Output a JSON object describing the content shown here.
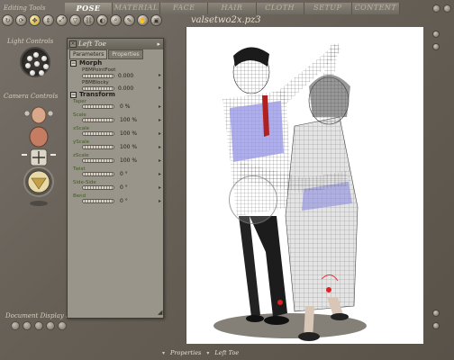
{
  "app": {
    "editing_tools_label": "Editing Tools",
    "document_title": "valsetwo2x.pz3"
  },
  "tabs": [
    "POSE",
    "MATERIAL",
    "FACE",
    "HAIR",
    "CLOTH",
    "SETUP",
    "CONTENT"
  ],
  "active_tab": "POSE",
  "tools": [
    {
      "icon": "rotate-icon"
    },
    {
      "icon": "twist-icon"
    },
    {
      "icon": "translate-icon"
    },
    {
      "icon": "translate-in-out-icon"
    },
    {
      "icon": "scale-icon"
    },
    {
      "icon": "taper-icon"
    },
    {
      "icon": "chain-break-icon"
    },
    {
      "icon": "color-icon"
    },
    {
      "icon": "view-magnifier-icon"
    },
    {
      "icon": "morph-brush-icon"
    },
    {
      "icon": "direct-manipulation-icon"
    },
    {
      "icon": "grouping-icon"
    }
  ],
  "left": {
    "light_controls_label": "Light Controls",
    "camera_controls_label": "Camera Controls",
    "document_display_label": "Document Display St"
  },
  "panel": {
    "title": "Left Toe",
    "tab_parameters": "Parameters",
    "tab_properties": "Properties",
    "morph_section": "Morph",
    "transform_section": "Transform",
    "morphs": [
      {
        "name": "PBMPointFoot",
        "value": "0.000"
      },
      {
        "name": "PBMBlocky",
        "value": "0.000"
      }
    ],
    "transforms": [
      {
        "name": "Taper",
        "value": "0 %"
      },
      {
        "name": "Scale",
        "value": "100 %"
      },
      {
        "name": "xScale",
        "value": "100 %"
      },
      {
        "name": "yScale",
        "value": "100 %"
      },
      {
        "name": "zScale",
        "value": "100 %"
      },
      {
        "name": "Twist",
        "value": "0 °"
      },
      {
        "name": "Side-Side",
        "value": "0 °"
      },
      {
        "name": "Bend",
        "value": "0 °"
      }
    ]
  },
  "bottom": {
    "item1": "Properties",
    "item2": "Left Toe"
  }
}
